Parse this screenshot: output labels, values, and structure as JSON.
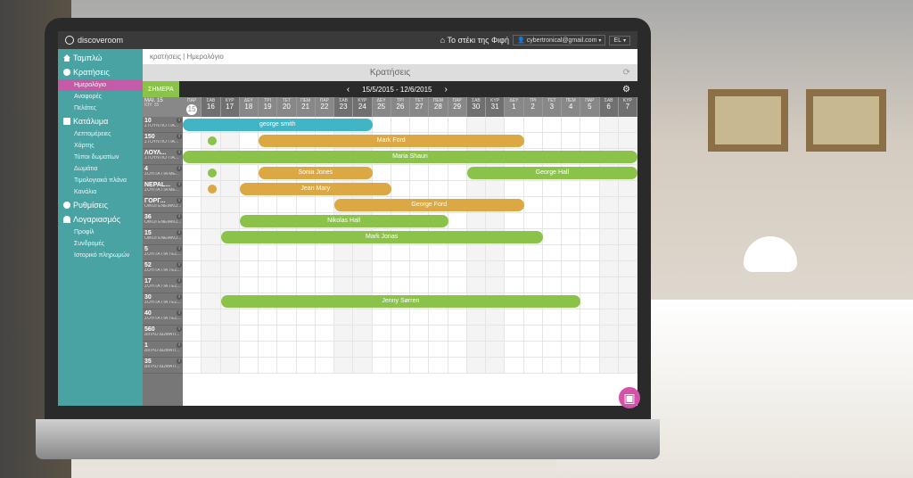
{
  "brand": "discoveroom",
  "header": {
    "property": "Το στέκι της Φιφή",
    "email": "cybertronical@gmail.com",
    "lang": "EL"
  },
  "sidebar": {
    "dashboard": "Ταμπλώ",
    "bookings": "Κρατήσεις",
    "bookings_sub": [
      "Ημερολόγιο",
      "Αναφορές",
      "Πελάτες"
    ],
    "property": "Κατάλυμα",
    "property_sub": [
      "Λεπτομέρειες",
      "Χάρτης",
      "Τύποι δωματίων",
      "Δωμάτια",
      "Τιμολογιακά πλάνα",
      "Κανάλια"
    ],
    "settings": "Ρυθμίσεις",
    "account": "Λογαριασμός",
    "account_sub": [
      "Προφίλ",
      "Συνδρομές",
      "Ιστορικό πληρωμών"
    ]
  },
  "breadcrumb": "κρατήσεις | Ημερολόγιο",
  "title": "Κρατήσεις",
  "toolbar": {
    "today": "ΣΗΜΕΡΑ",
    "range": "15/5/2015 - 12/6/2015"
  },
  "monthhead": {
    "l1": "MAI. 15",
    "l2": "IΟΥ. 15"
  },
  "days": [
    {
      "n": "ΠΑΡ",
      "d": "15",
      "we": false,
      "today": true
    },
    {
      "n": "ΣΑΒ",
      "d": "16",
      "we": true
    },
    {
      "n": "ΚΥΡ",
      "d": "17",
      "we": true
    },
    {
      "n": "ΔΕΥ",
      "d": "18"
    },
    {
      "n": "ΤΡΙ",
      "d": "19"
    },
    {
      "n": "ΤΕΤ",
      "d": "20"
    },
    {
      "n": "ΠΕΜ",
      "d": "21"
    },
    {
      "n": "ΠΑΡ",
      "d": "22"
    },
    {
      "n": "ΣΑΒ",
      "d": "23",
      "we": true
    },
    {
      "n": "ΚΥΡ",
      "d": "24",
      "we": true
    },
    {
      "n": "ΔΕΥ",
      "d": "25"
    },
    {
      "n": "ΤΡΙ",
      "d": "26"
    },
    {
      "n": "ΤΕΤ",
      "d": "27"
    },
    {
      "n": "ΠΕΜ",
      "d": "28"
    },
    {
      "n": "ΠΑΡ",
      "d": "29"
    },
    {
      "n": "ΣΑΒ",
      "d": "30",
      "we": true
    },
    {
      "n": "ΚΥΡ",
      "d": "31",
      "we": true
    },
    {
      "n": "ΔΕΥ",
      "d": "1"
    },
    {
      "n": "ΤΡΙ",
      "d": "2"
    },
    {
      "n": "ΤΕΤ",
      "d": "3"
    },
    {
      "n": "ΠΕΜ",
      "d": "4"
    },
    {
      "n": "ΠΑΡ",
      "d": "5"
    },
    {
      "n": "ΣΑΒ",
      "d": "6",
      "we": true
    },
    {
      "n": "ΚΥΡ",
      "d": "7",
      "we": true
    }
  ],
  "rooms": [
    {
      "name": "10",
      "desc": "ΣΤΟΥΝΤΙΟ ΓΙΑ..."
    },
    {
      "name": "150",
      "desc": "ΣΤΟΥΝΤΙΟ ΓΙΑ..."
    },
    {
      "name": "ΛΟΥΛ...",
      "desc": "ΣΤΟΥΝΤΙΟ ΓΙΑ..."
    },
    {
      "name": "4",
      "desc": "ΣΟΥΙΤΑ ΓΙΑ ΜΕ..."
    },
    {
      "name": "NEPAL...",
      "desc": "ΣΟΥΙΤΑ ΓΙΑ ΜΕ..."
    },
    {
      "name": "ΓΟΡΓ...",
      "desc": "ΟΙΚΟΓΕΝΕΙΑΚΟ..."
    },
    {
      "name": "36",
      "desc": "ΟΙΚΟΓΕΝΕΙΑΚΟ..."
    },
    {
      "name": "15",
      "desc": "ΟΙΚΟΓΕΝΕΙΑΚΟ..."
    },
    {
      "name": "5",
      "desc": "ΣΟΥΙΤΑ ΓΙΑ ΤΕΣ..."
    },
    {
      "name": "52",
      "desc": "ΣΟΥΙΤΑ ΓΙΑ ΤΕΣ..."
    },
    {
      "name": "17",
      "desc": "ΣΟΥΙΤΑ ΓΙΑ ΤΕΣ..."
    },
    {
      "name": "30",
      "desc": "ΣΟΥΙΤΑ ΓΙΑ ΤΕΣ..."
    },
    {
      "name": "40",
      "desc": "ΣΟΥΙΤΑ ΓΙΑ ΤΕΣ..."
    },
    {
      "name": "560",
      "desc": "ΔΙΠΛΟ ΔΩΜΑΤΙ..."
    },
    {
      "name": "1",
      "desc": "ΔΙΠΛΟ ΔΩΜΑΤΙ..."
    },
    {
      "name": "35",
      "desc": "ΔΙΠΛΟ ΔΩΜΑΤΙ..."
    }
  ],
  "bookings": [
    {
      "row": 0,
      "start": 0,
      "span": 10,
      "color": "b",
      "label": "george smith"
    },
    {
      "row": 1,
      "start": 4,
      "span": 14,
      "color": "o",
      "label": "Mark Ford"
    },
    {
      "row": 1,
      "start": 1,
      "span": 1,
      "color": "g",
      "label": "",
      "dot": true
    },
    {
      "row": 2,
      "start": 0,
      "span": 24,
      "color": "g",
      "label": "Maria Shaun"
    },
    {
      "row": 3,
      "start": 4,
      "span": 6,
      "color": "o",
      "label": "Sonia Jones"
    },
    {
      "row": 3,
      "start": 15,
      "span": 9,
      "color": "g",
      "label": "George Hall"
    },
    {
      "row": 3,
      "start": 1,
      "span": 1,
      "color": "g",
      "label": "",
      "dot": true
    },
    {
      "row": 4,
      "start": 3,
      "span": 8,
      "color": "o",
      "label": "Jean Mary"
    },
    {
      "row": 4,
      "start": 1,
      "span": 1,
      "color": "o",
      "label": "",
      "dot": true
    },
    {
      "row": 5,
      "start": 8,
      "span": 10,
      "color": "o",
      "label": "George Ford"
    },
    {
      "row": 6,
      "start": 3,
      "span": 11,
      "color": "g",
      "label": "Nikolas Hall"
    },
    {
      "row": 7,
      "start": 2,
      "span": 17,
      "color": "g",
      "label": "Mark Jonas"
    },
    {
      "row": 11,
      "start": 2,
      "span": 19,
      "color": "g",
      "label": "Jenny Sørren"
    }
  ],
  "colors": {
    "g": "#8bc34a",
    "b": "#3fb5c6",
    "o": "#dba843",
    "accent": "#d453a8",
    "teal": "#49a3a3"
  },
  "fab_icon": "camera-icon",
  "fab_glyph": "▣"
}
